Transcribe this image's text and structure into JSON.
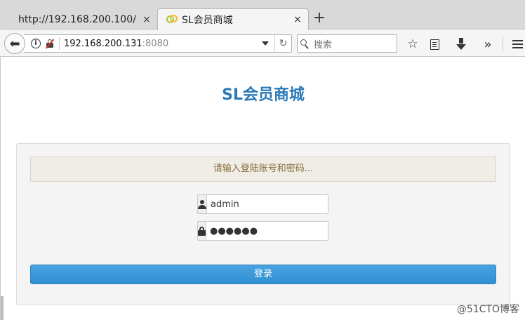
{
  "browser": {
    "tabs": [
      {
        "title": "http://192.168.200.100/",
        "close": "×"
      },
      {
        "title": "SL会员商城",
        "close": "×"
      }
    ],
    "new_tab": "+",
    "url": {
      "host": "192.168.200.131",
      "port": ":8080"
    },
    "search": {
      "placeholder": "搜索"
    },
    "icons": {
      "back": "back-arrow-icon",
      "reload": "reload-icon",
      "bookmark": "star-icon",
      "reader": "reader-view-icon",
      "download": "download-icon",
      "overflow": "overflow-chevron-icon",
      "menu": "hamburger-menu-icon"
    }
  },
  "page": {
    "title": "SL会员商城",
    "prompt": "请输入登陆账号和密码...",
    "username_value": "admin",
    "password_value": "●●●●●●",
    "login_label": "登录",
    "watermark": "@51CTO博客"
  },
  "colors": {
    "title": "#2b79b7",
    "button": "#3a9ad9",
    "prompt_bg": "#efede6"
  }
}
